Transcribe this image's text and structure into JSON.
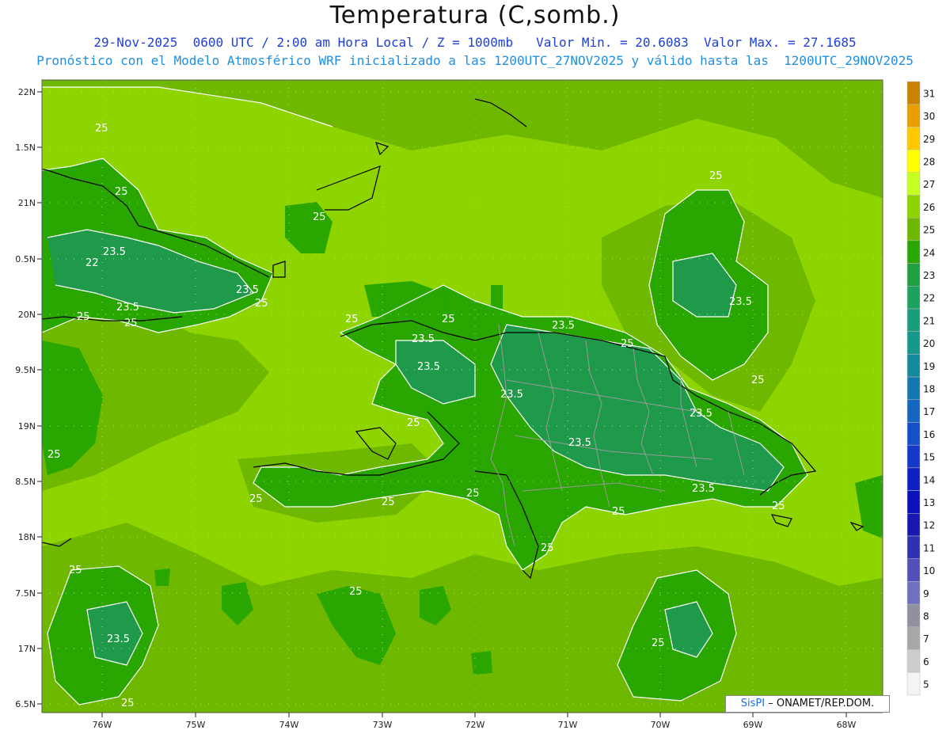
{
  "header": {
    "title": "Temperatura (C,somb.)",
    "subtitle_line1": "29-Nov-2025  0600 UTC / 2:00 am Hora Local / Z = 1000mb   Valor Min. = 20.6083  Valor Max. = 27.1685",
    "subtitle_line2": "Pronóstico con el Modelo Atmosférico WRF inicializado a las 1200UTC_27NOV2025 y válido hasta las  1200UTC_29NOV2025"
  },
  "map": {
    "lat_labels": [
      "22N",
      "1.5N",
      "21N",
      "0.5N",
      "20N",
      "9.5N",
      "19N",
      "8.5N",
      "18N",
      "7.5N",
      "17N",
      "6.5N"
    ],
    "lon_labels": [
      "76W",
      "75W",
      "74W",
      "73W",
      "72W",
      "71W",
      "70W",
      "69W",
      "68W"
    ],
    "contour_labels": [
      "25",
      "25",
      "25",
      "22",
      "23.5",
      "23.5",
      "23.5",
      "25",
      "25",
      "25",
      "25",
      "23.5",
      "23.5",
      "23.5",
      "25",
      "25",
      "25",
      "23.5",
      "25",
      "23.5",
      "25",
      "25",
      "23.5",
      "23.5",
      "25",
      "25",
      "25",
      "25",
      "25",
      "25",
      "23.5",
      "25",
      "25",
      "25",
      "23.5",
      "25"
    ],
    "colors": {
      "ocean_26": "#8ed400",
      "warm_25_26": "#6fb800",
      "land_24": "#29a600",
      "land_23": "#1f9a4a",
      "coast": "#000000",
      "borders": "#9a9a9a",
      "contour": "#ffffff"
    }
  },
  "colorbar": {
    "labels": [
      "31",
      "30",
      "29",
      "28",
      "27",
      "26",
      "25",
      "24",
      "23",
      "22",
      "21",
      "20",
      "19",
      "18",
      "17",
      "16",
      "15",
      "14",
      "13",
      "12",
      "11",
      "10",
      "9",
      "8",
      "7",
      "6",
      "5"
    ],
    "colors": [
      "#c98200",
      "#e8a000",
      "#ffc800",
      "#ffff00",
      "#c6ff20",
      "#8ed400",
      "#6fb800",
      "#29a600",
      "#20a040",
      "#1ea060",
      "#1a9d7a",
      "#17988c",
      "#148a9c",
      "#1478b0",
      "#1466c0",
      "#1450c8",
      "#1438c8",
      "#1020c0",
      "#0c10b8",
      "#1818b0",
      "#3030b0",
      "#5050b8",
      "#7070c0",
      "#9090a0",
      "#a8a8a8",
      "#cccccc",
      "#f4f4f4"
    ]
  },
  "credit": {
    "brand": "SisPI",
    "text": "– ONAMET/REP.DOM."
  }
}
